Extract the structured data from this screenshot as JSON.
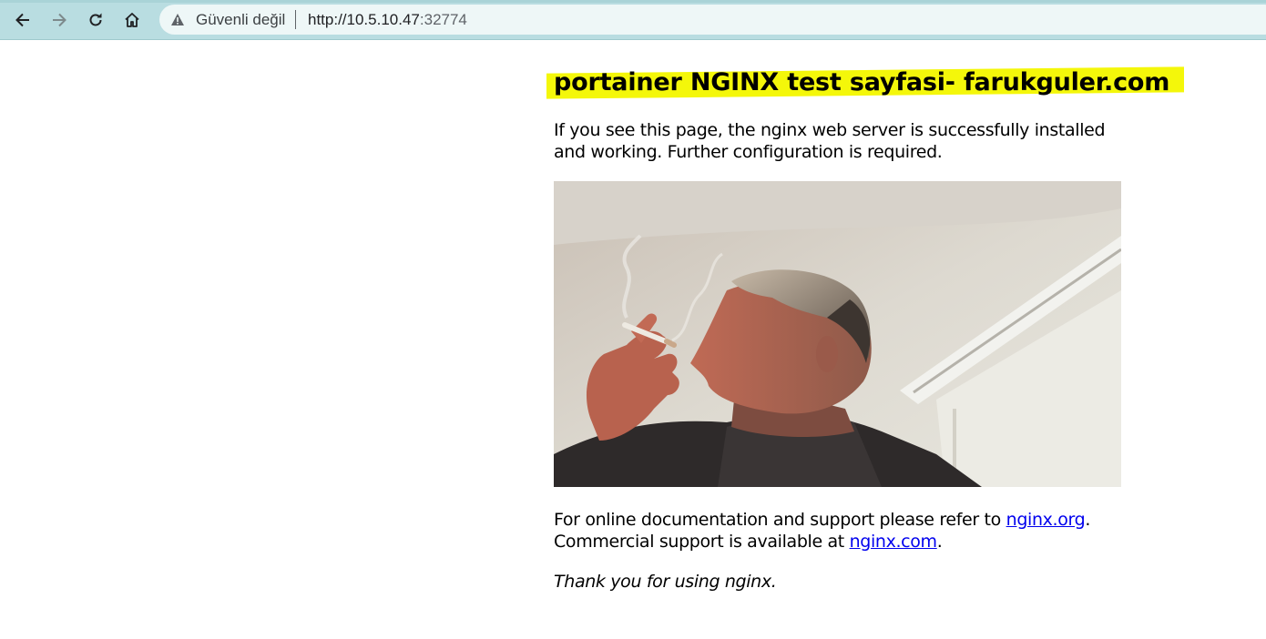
{
  "browser": {
    "security_label": "Güvenli değil",
    "url_host": "http://10.5.10.47",
    "url_port": ":32774"
  },
  "page": {
    "heading": "portainer NGINX test sayfasi- farukguler.com",
    "intro": "If you see this page, the nginx web server is successfully installed and working. Further configuration is required.",
    "docs_prefix": "For online documentation and support please refer to ",
    "docs_link": "nginx.org",
    "docs_suffix": ".",
    "commercial_prefix": "Commercial support is available at ",
    "commercial_link": "nginx.com",
    "commercial_suffix": ".",
    "thanks": "Thank you for using nginx."
  },
  "colors": {
    "toolbar": "#b9dde1",
    "highlight": "#f4f70a",
    "link": "#0000ee"
  }
}
